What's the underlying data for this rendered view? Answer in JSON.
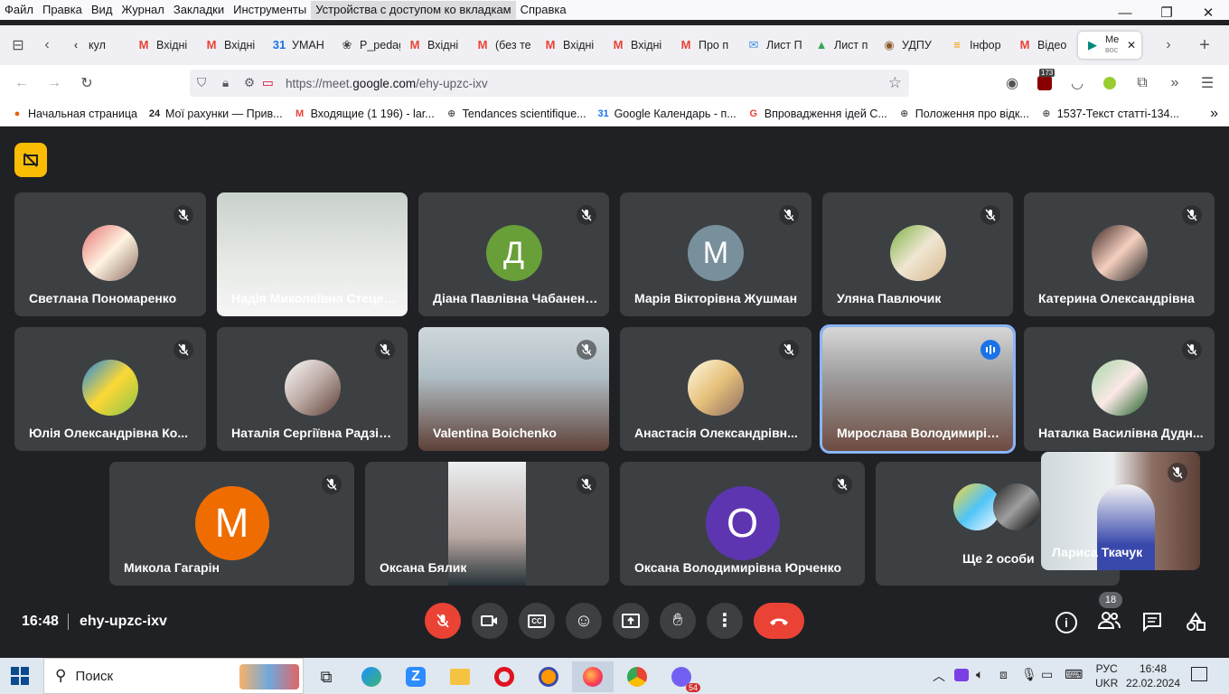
{
  "menu": [
    "Файл",
    "Правка",
    "Вид",
    "Журнал",
    "Закладки",
    "Инструменты",
    "Устройства с доступом ко вкладкам",
    "Справка"
  ],
  "tabs": [
    {
      "label": "кул",
      "fav": "‹",
      "color": "#555"
    },
    {
      "label": "Вхідні",
      "fav": "M",
      "color": "#ea4335"
    },
    {
      "label": "Вхідні",
      "fav": "M",
      "color": "#ea4335"
    },
    {
      "label": "УМАН",
      "fav": "31",
      "color": "#1a73e8"
    },
    {
      "label": "P_pedag",
      "fav": "❀",
      "color": "#444"
    },
    {
      "label": "Вхідні",
      "fav": "M",
      "color": "#ea4335"
    },
    {
      "label": "(без те",
      "fav": "M",
      "color": "#ea4335"
    },
    {
      "label": "Вхідні",
      "fav": "M",
      "color": "#ea4335"
    },
    {
      "label": "Вхідні",
      "fav": "M",
      "color": "#ea4335"
    },
    {
      "label": "Про п",
      "fav": "M",
      "color": "#ea4335"
    },
    {
      "label": "Лист П",
      "fav": "✉",
      "color": "#4a90e2"
    },
    {
      "label": "Лист п",
      "fav": "▲",
      "color": "#34a853"
    },
    {
      "label": "УДПУ",
      "fav": "◉",
      "color": "#8a5a2b"
    },
    {
      "label": "Інфор",
      "fav": "≡",
      "color": "#f29900"
    },
    {
      "label": "Відео",
      "fav": "M",
      "color": "#ea4335"
    }
  ],
  "active_tab": {
    "label1": "Me",
    "label2": "вос",
    "fav": "▶"
  },
  "url": {
    "prefix": "https://meet.",
    "domain": "google.com",
    "path": "/ehy-upzc-ixv"
  },
  "ext_badge": "173",
  "bookmarks": [
    {
      "label": "Начальная страница",
      "icon": "●",
      "color": "#e66000"
    },
    {
      "label": "Мої рахунки — Прив...",
      "icon": "24",
      "color": "#222"
    },
    {
      "label": "Входящие (1 196) - lar...",
      "icon": "M",
      "color": "#ea4335"
    },
    {
      "label": "Tendances scientifique...",
      "icon": "⊕",
      "color": "#555"
    },
    {
      "label": "Google Календарь - п...",
      "icon": "31",
      "color": "#1a73e8"
    },
    {
      "label": "Впровадження ідей С...",
      "icon": "G",
      "color": "#ea4335"
    },
    {
      "label": "Положення про відк...",
      "icon": "⊕",
      "color": "#555"
    },
    {
      "label": "1537-Текст статті-134...",
      "icon": "⊕",
      "color": "#555"
    }
  ],
  "participants": [
    {
      "name": "Светлана Пономаренко"
    },
    {
      "name": "Надія Миколаївна Стецевич"
    },
    {
      "name": "Діана Павлівна Чабаненко",
      "initial": "Д"
    },
    {
      "name": "Марія Вікторівна Жушман",
      "initial": "М"
    },
    {
      "name": "Уляна Павлючик"
    },
    {
      "name": "Катерина Олександрівна"
    },
    {
      "name": "Юлія Олександрівна Ко..."
    },
    {
      "name": "Наталія Сергіївна Радзів..."
    },
    {
      "name": "Valentina Boichenko"
    },
    {
      "name": "Анастасія Олександрівн..."
    },
    {
      "name": "Мирослава Володимирівна"
    },
    {
      "name": "Наталка Василівна Дудн..."
    },
    {
      "name": "Микола Гагарін",
      "initial": "М"
    },
    {
      "name": "Оксана Бялик"
    },
    {
      "name": "Оксана Володимирівна Юрченко",
      "initial": "О"
    },
    {
      "name": "Ще 2 особи"
    },
    {
      "name": "Лариса Ткачук"
    }
  ],
  "colors": {
    "diana": "#689f38",
    "maria": "#78909c",
    "mykola": "#ef6c00",
    "oksana": "#5e35b1",
    "accent": "#8ab4f8",
    "red": "#ea4335",
    "host": "#fbbc04"
  },
  "meeting": {
    "time": "16:48",
    "code": "ehy-upzc-ixv",
    "people_count": "18"
  },
  "taskbar": {
    "search": "Поиск",
    "lang1": "РУС",
    "lang2": "UKR",
    "time": "16:48",
    "date": "22.02.2024",
    "viber_badge": "54"
  }
}
